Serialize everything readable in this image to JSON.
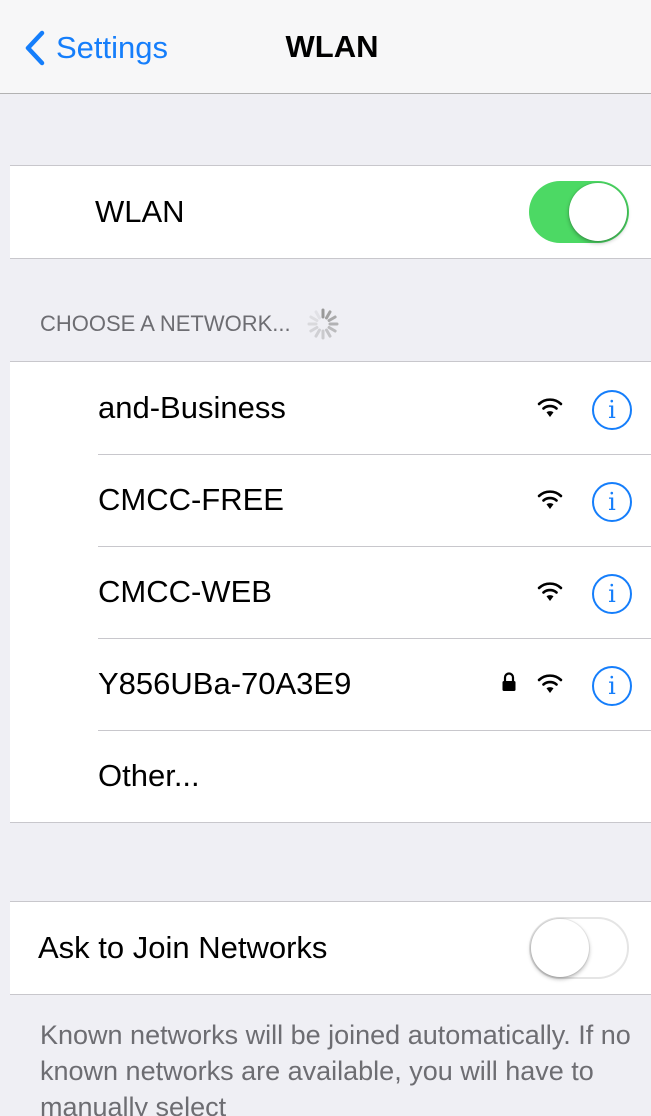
{
  "navbar": {
    "back_label": "Settings",
    "title": "WLAN"
  },
  "wlan": {
    "label": "WLAN",
    "enabled": true
  },
  "networks": {
    "header": "CHOOSE A NETWORK...",
    "items": [
      {
        "name": "and-Business",
        "secured": false
      },
      {
        "name": "CMCC-FREE",
        "secured": false
      },
      {
        "name": "CMCC-WEB",
        "secured": false
      },
      {
        "name": "Y856UBa-70A3E9",
        "secured": true
      }
    ],
    "other_label": "Other..."
  },
  "ask_to_join": {
    "label": "Ask to Join Networks",
    "enabled": false
  },
  "footer": "Known networks will be joined automatically. If no known networks are available, you will have to manually select",
  "icons": {
    "back": "chevron-left-icon",
    "spinner": "spinner-icon",
    "wifi": "wifi-icon",
    "lock": "lock-icon",
    "info": "info-icon"
  },
  "colors": {
    "accent": "#157efb",
    "toggle_on": "#4cd964",
    "background": "#efeff4",
    "secondary_text": "#6d6d72"
  }
}
